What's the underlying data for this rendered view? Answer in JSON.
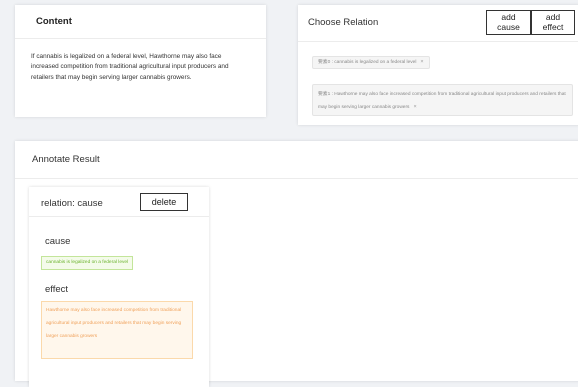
{
  "content": {
    "title": "Content",
    "text": "If cannabis is legalized on a federal level, Hawthorne may also face increased competition from traditional agricultural input producers and retailers that may begin serving larger cannabis growers."
  },
  "relation": {
    "title": "Choose Relation",
    "add_cause_label": "add\ncause",
    "add_effect_label": "add\neffect",
    "tags": [
      {
        "text": "要素0 : cannabis is legalized on a federal level",
        "close": "×"
      },
      {
        "text": "要素1 : Hawthorne may also face increased competition from traditional agricultural input producers and retailers that may begin serving larger cannabis growers",
        "close": "×"
      }
    ]
  },
  "annotate": {
    "title": "Annotate Result",
    "relation_title": "relation: cause",
    "delete_label": "delete",
    "cause_label": "cause",
    "cause_text": "cannabis is legalized on a federal level",
    "effect_label": "effect",
    "effect_text": "Hawthorne may also face increased competition from traditional agricultural input producers and retailers that may begin serving larger cannabis growers"
  }
}
